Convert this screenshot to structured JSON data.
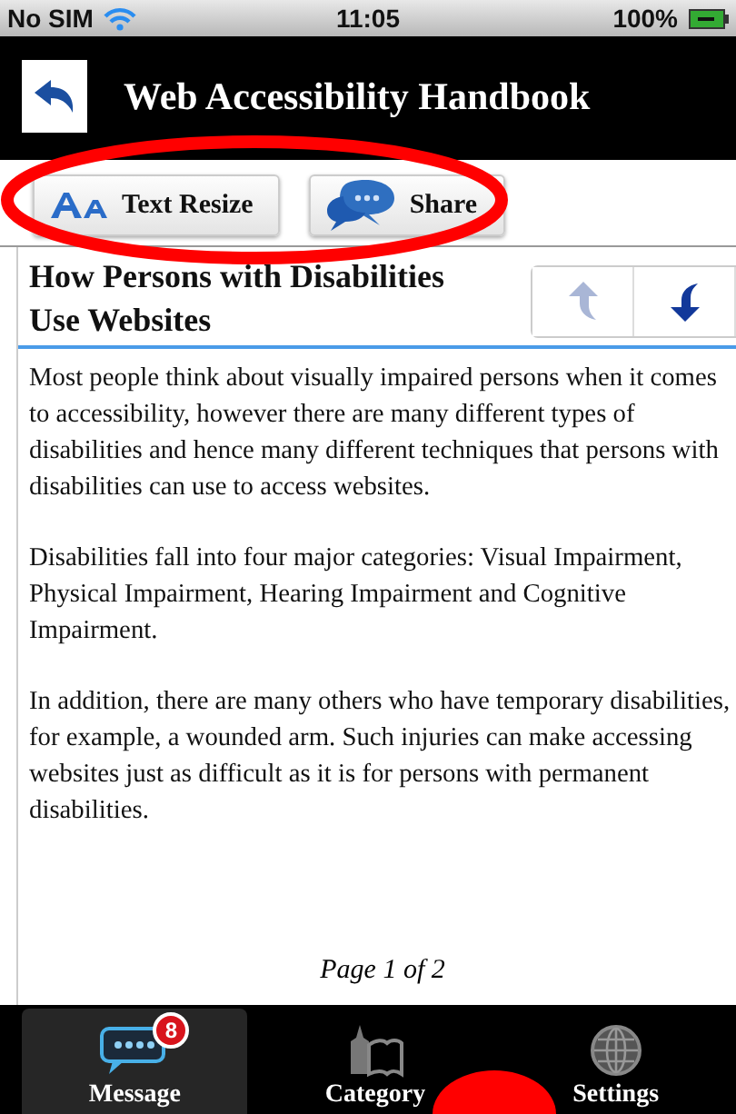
{
  "status_bar": {
    "carrier": "No SIM",
    "time": "11:05",
    "battery": "100%"
  },
  "header": {
    "title": "Web Accessibility Handbook"
  },
  "toolbar": [
    {
      "label": "Text Resize",
      "kind": "resize"
    },
    {
      "label": "Share",
      "kind": "share"
    }
  ],
  "article": {
    "title": "How Persons with Disabilities Use Websites",
    "nav_buttons": [
      {
        "kind": "up",
        "disabled": true
      },
      {
        "kind": "down",
        "disabled": false
      }
    ],
    "paragraphs": [
      "Most people think about visually impaired persons when it comes to accessibility, however there are many different types of disabilities and hence many different techniques that persons with disabilities can use to access websites.",
      "Disabilities fall into four major categories: Visual Impairment, Physical Impairment, Hearing Impairment and Cognitive Impairment.",
      "In addition, there are many others who have temporary disabilities, for example, a wounded arm. Such injuries can make accessing websites just as difficult as it is for persons with permanent disabilities."
    ],
    "page_indicator": "Page 1 of 2"
  },
  "tab_bar": [
    {
      "label": "Message",
      "kind": "message",
      "selected": true,
      "badge": "8"
    },
    {
      "label": "Category",
      "kind": "category",
      "selected": false
    },
    {
      "label": "Settings",
      "kind": "settings",
      "selected": false
    }
  ],
  "annotations": [
    {
      "kind": "ellipse"
    },
    {
      "kind": "circle"
    }
  ]
}
